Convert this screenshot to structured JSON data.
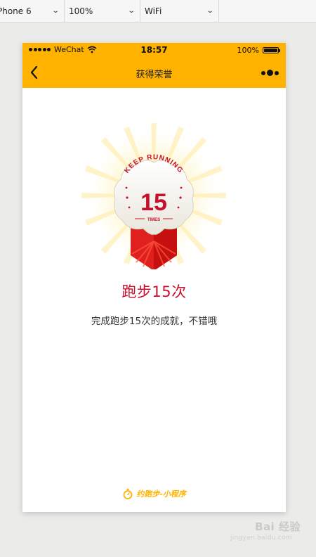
{
  "toolbar": {
    "device": "Phone 6",
    "zoom": "100%",
    "network": "WiFi"
  },
  "statusbar": {
    "carrier": "WeChat",
    "time": "18:57",
    "battery": "100%"
  },
  "navbar": {
    "title": "获得荣誉"
  },
  "badge": {
    "arc_text": "KEEP RUNNING",
    "number": "15",
    "sub_text": "TIMES"
  },
  "achievement": {
    "title": "跑步15次",
    "description": "完成跑步15次的成就，不错哦"
  },
  "footer": {
    "brand": "约跑步-小程序"
  },
  "watermark": {
    "main": "Bai 经验",
    "sub": "jingyan.baidu.com"
  },
  "colors": {
    "accent": "#ffb300",
    "title_red": "#c8102e"
  }
}
